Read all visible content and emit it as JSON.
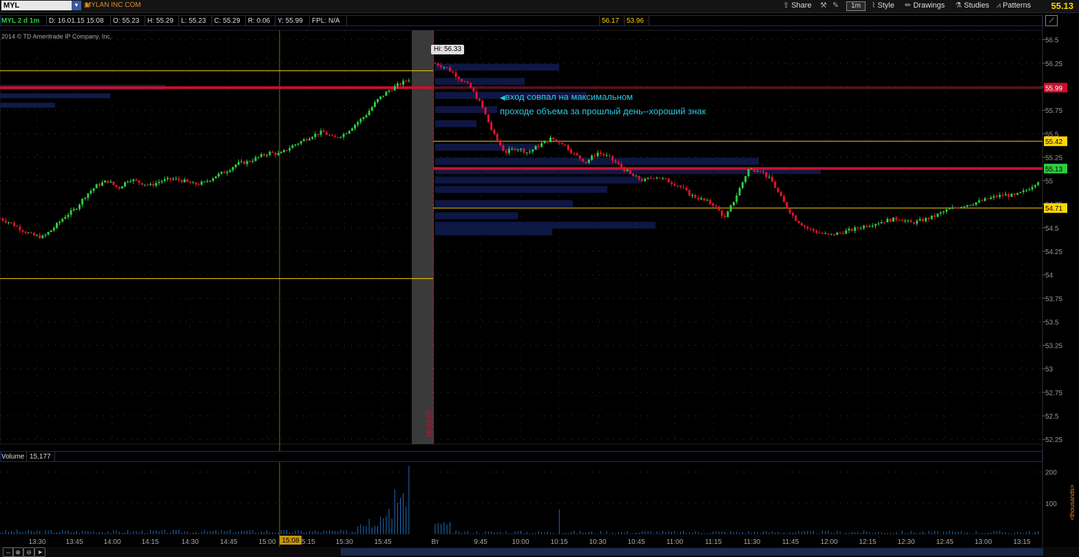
{
  "toolbar": {
    "symbol": "MYL",
    "company": "MYLAN INC COM",
    "share_label": "Share",
    "timeframe": "1m",
    "style_label": "Style",
    "drawings_label": "Drawings",
    "studies_label": "Studies",
    "patterns_label": "Patterns",
    "last_price": "55.13"
  },
  "info": {
    "title": "MYL 2 d 1m",
    "date": "D: 16.01.15 15:08",
    "open": "O: 55.23",
    "high": "H: 55.29",
    "low": "L: 55.23",
    "close": "C: 55.29",
    "range": "R: 0.06",
    "yclose": "Y: 55.99",
    "fpl": "FPL: N/A",
    "hi_val": "56.17",
    "lo_val": "53.96",
    "copyright": "2014 © TD Ameritrade IP Company, Inc."
  },
  "annotation": {
    "line1": "вход совпал на максимальном",
    "line2": "проходе объема за прошлый день--хороший знак"
  },
  "hi_tag": "Hi: 56.33",
  "session_break_label": "16.01.15",
  "crosshair_time": "15:08",
  "volume": {
    "label": "Volume",
    "value": "15,177",
    "unit_label": "<thousands>",
    "ticks": [
      "200",
      "100"
    ]
  },
  "chart_data": {
    "type": "candlestick",
    "price_axis_ticks": [
      "56.5",
      "56.25",
      "56",
      "55.75",
      "55.5",
      "55.25",
      "55",
      "54.75",
      "54.5",
      "54.25",
      "54",
      "53.75",
      "53.5",
      "53.25",
      "53",
      "52.75",
      "52.5",
      "52.25"
    ],
    "ylim": [
      52.2,
      56.6
    ],
    "price_tags": [
      {
        "value": "55.99",
        "color": "#c8102e"
      },
      {
        "value": "55.42",
        "color": "#ffd700"
      },
      {
        "value": "55.13",
        "color": "#2ecc40"
      },
      {
        "value": "54.71",
        "color": "#ffd700"
      }
    ],
    "horizontal_levels": [
      {
        "price": 56.17,
        "color": "#ffd700",
        "session": "prev"
      },
      {
        "price": 55.99,
        "color": "#c8102e",
        "session": "prev"
      },
      {
        "price": 53.96,
        "color": "#ffd700",
        "session": "prev"
      },
      {
        "price": 55.42,
        "color": "#ffd700",
        "session": "curr"
      },
      {
        "price": 55.13,
        "color": "#c8102e",
        "session": "curr"
      },
      {
        "price": 54.71,
        "color": "#ffd700",
        "session": "curr"
      },
      {
        "price": 55.99,
        "color": "#8a2030",
        "session": "curr"
      }
    ],
    "time_labels_prev": [
      "13:30",
      "13:45",
      "14:00",
      "14:15",
      "14:30",
      "14:45",
      "15:00",
      "15:15",
      "15:30",
      "15:45"
    ],
    "session_marker": "Вт",
    "time_labels_curr": [
      "9:45",
      "10:00",
      "10:15",
      "10:30",
      "10:45",
      "11:00",
      "11:15",
      "11:30",
      "11:45",
      "12:00",
      "12:15",
      "12:30",
      "12:45",
      "13:00",
      "13:15"
    ],
    "series_prev": [
      54.6,
      54.55,
      54.48,
      54.42,
      54.4,
      54.5,
      54.62,
      54.7,
      54.85,
      54.95,
      55.0,
      54.92,
      55.02,
      54.98,
      54.95,
      55.0,
      55.02,
      55.0,
      54.96,
      54.98,
      55.05,
      55.1,
      55.18,
      55.2,
      55.25,
      55.3,
      55.28,
      55.36,
      55.42,
      55.48,
      55.52,
      55.45,
      55.5,
      55.6,
      55.7,
      55.85,
      55.95,
      56.02,
      56.08
    ],
    "series_curr": [
      56.25,
      56.2,
      56.1,
      56.0,
      55.8,
      55.5,
      55.3,
      55.35,
      55.3,
      55.38,
      55.45,
      55.4,
      55.28,
      55.2,
      55.3,
      55.25,
      55.15,
      55.05,
      55.0,
      55.05,
      55.0,
      54.95,
      54.85,
      54.8,
      54.75,
      54.6,
      54.85,
      55.12,
      55.12,
      55.0,
      54.78,
      54.6,
      54.5,
      54.45,
      54.42,
      54.45,
      54.48,
      54.52,
      54.55,
      54.58,
      54.6,
      54.55,
      54.58,
      54.62,
      54.68,
      54.72,
      54.75,
      54.78,
      54.82,
      54.85,
      54.84,
      54.9,
      55.0
    ]
  }
}
